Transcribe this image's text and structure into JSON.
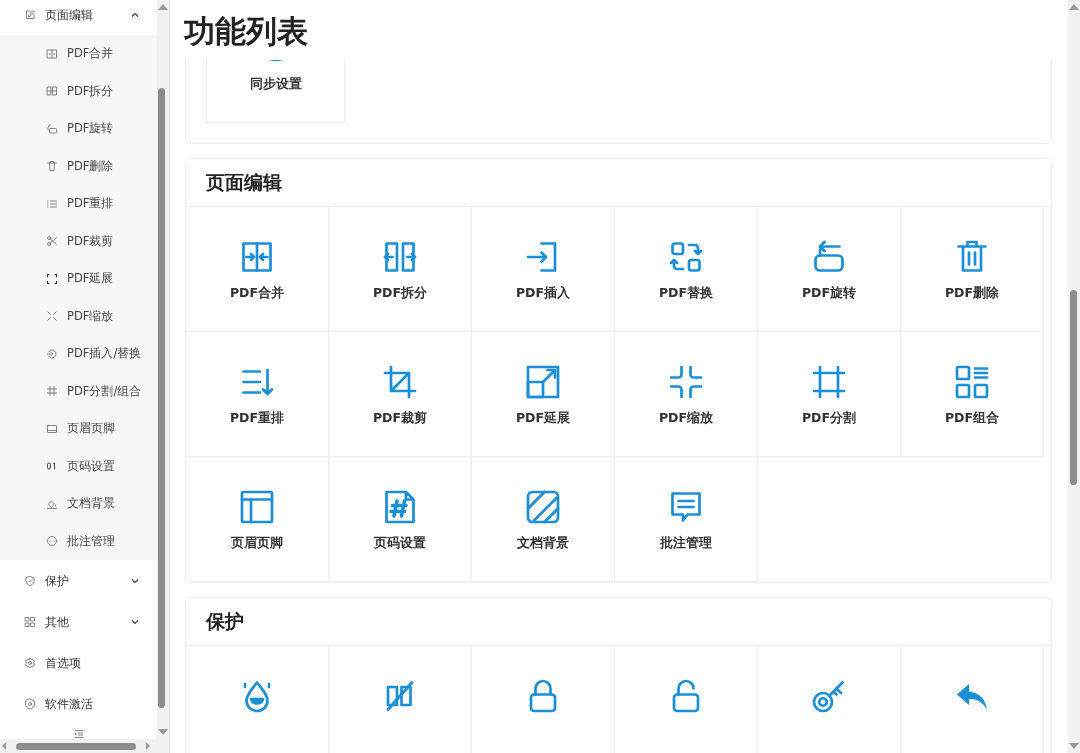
{
  "sidebar": {
    "items": [
      {
        "label": "页面编辑",
        "expanded": true,
        "children": [
          {
            "label": "PDF合并"
          },
          {
            "label": "PDF拆分"
          },
          {
            "label": "PDF旋转"
          },
          {
            "label": "PDF删除"
          },
          {
            "label": "PDF重排"
          },
          {
            "label": "PDF裁剪"
          },
          {
            "label": "PDF延展"
          },
          {
            "label": "PDF缩放"
          },
          {
            "label": "PDF插入/替换"
          },
          {
            "label": "PDF分割/组合"
          },
          {
            "label": "页眉页脚"
          },
          {
            "label": "页码设置"
          },
          {
            "label": "文档背景"
          },
          {
            "label": "批注管理"
          }
        ]
      },
      {
        "label": "保护",
        "expanded": false
      },
      {
        "label": "其他",
        "expanded": false
      },
      {
        "label": "首选项"
      },
      {
        "label": "软件激活"
      }
    ]
  },
  "page_title": "功能列表",
  "sections": [
    {
      "tiles": [
        {
          "kind": "labeled",
          "label": "同步设置"
        }
      ]
    },
    {
      "title": "页面编辑",
      "tiles": [
        {
          "kind": "labeled",
          "label": "PDF合并"
        },
        {
          "kind": "labeled",
          "label": "PDF拆分"
        },
        {
          "kind": "labeled",
          "label": "PDF插入"
        },
        {
          "kind": "labeled",
          "label": "PDF替换"
        },
        {
          "kind": "labeled",
          "label": "PDF旋转"
        },
        {
          "kind": "labeled",
          "label": "PDF删除"
        },
        {
          "kind": "labeled",
          "label": "PDF重排"
        },
        {
          "kind": "labeled",
          "label": "PDF裁剪"
        },
        {
          "kind": "labeled",
          "label": "PDF延展"
        },
        {
          "kind": "labeled",
          "label": "PDF缩放"
        },
        {
          "kind": "labeled",
          "label": "PDF分割"
        },
        {
          "kind": "labeled",
          "label": "PDF组合"
        },
        {
          "kind": "labeled",
          "label": "页眉页脚"
        },
        {
          "kind": "labeled",
          "label": "页码设置"
        },
        {
          "kind": "labeled",
          "label": "文档背景"
        },
        {
          "kind": "labeled",
          "label": "批注管理"
        }
      ]
    },
    {
      "title": "保护",
      "tiles": [
        {
          "kind": "icon"
        },
        {
          "kind": "icon"
        },
        {
          "kind": "icon"
        },
        {
          "kind": "icon"
        },
        {
          "kind": "icon"
        },
        {
          "kind": "icon"
        }
      ]
    }
  ]
}
